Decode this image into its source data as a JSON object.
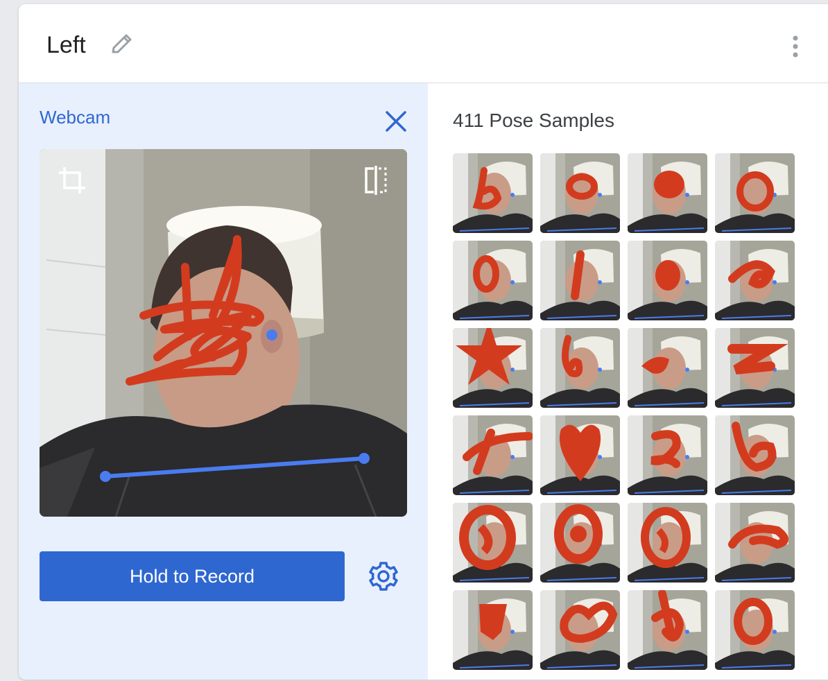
{
  "header": {
    "title": "Left",
    "edit_icon": "pencil-icon",
    "more_icon": "more-vertical-icon"
  },
  "webcam": {
    "label": "Webcam",
    "close_icon": "close-icon",
    "crop_icon": "crop-icon",
    "flip_icon": "flip-icon",
    "record_label": "Hold to Record",
    "settings_icon": "gear-icon"
  },
  "samples": {
    "title": "411 Pose Samples",
    "count_visible": 24
  },
  "colors": {
    "accent": "#2f67d1",
    "panel_bg": "#e8f0fd",
    "scribble": "#d33b1f",
    "keypoint": "#4a7cf0"
  }
}
